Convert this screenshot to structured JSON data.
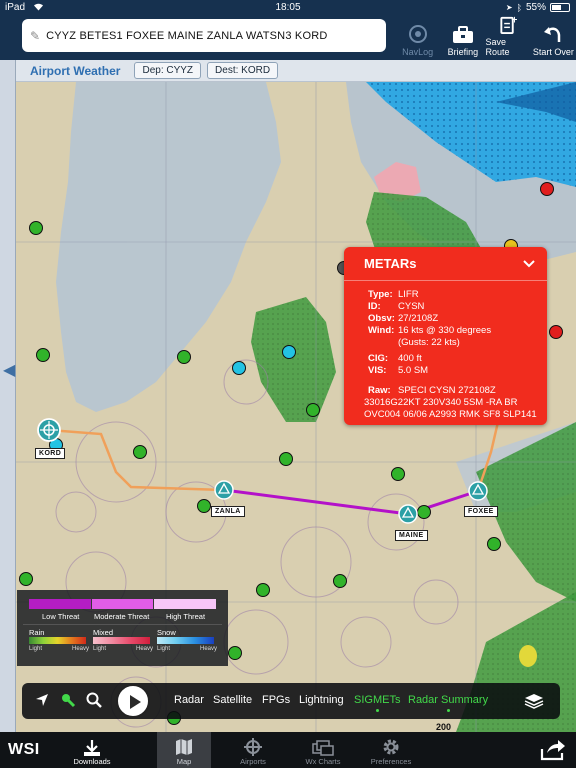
{
  "status_bar": {
    "device": "iPad",
    "wifi_icon": "wifi-icon",
    "time": "18:05",
    "battery": "55%",
    "battery_level": 0.55
  },
  "header": {
    "route": "CYYZ BETES1 FOXEE MAINE ZANLA WATSN3 KORD",
    "tools": [
      {
        "label": "NavLog",
        "icon": "target-icon",
        "enabled": false
      },
      {
        "label": "Briefing",
        "icon": "briefcase-icon",
        "enabled": true
      },
      {
        "label": "Save Route",
        "icon": "save-route-icon",
        "enabled": true
      },
      {
        "label": "Start Over",
        "icon": "undo-icon",
        "enabled": true
      }
    ]
  },
  "airport_weather": {
    "title": "Airport Weather",
    "dep": "Dep: CYYZ",
    "dest": "Dest: KORD"
  },
  "map": {
    "airports": [
      "KORD",
      "ZANLA",
      "MAINE",
      "FOXEE"
    ],
    "colors": {
      "route": "#b311c9",
      "path": "#f0a05a",
      "metar_green": "#31b32a",
      "metar_cyan": "#23c3e4",
      "metar_red": "#e01e1e",
      "airmet": "#3ba83a",
      "sigmet": "#1c9ae0"
    },
    "map_label": "200"
  },
  "metar_popup": {
    "title": "METARs",
    "rows": [
      {
        "k": "Type:",
        "v": "LIFR"
      },
      {
        "k": "ID:",
        "v": "CYSN"
      },
      {
        "k": "Obsv:",
        "v": "27/2108Z"
      },
      {
        "k": "Wind:",
        "v": "16 kts @ 330 degrees",
        "v2": "(Gusts: 22 kts)"
      },
      {
        "k": "CIG:",
        "v": "400 ft"
      },
      {
        "k": "VIS:",
        "v": "5.0 SM"
      }
    ],
    "raw_label": "Raw:",
    "raw": "SPECI CYSN 272108Z 33016G22KT 230V340 5SM -RA BR OVC004 06/06 A2993 RMK SF8 SLP141"
  },
  "legend": {
    "threats": [
      {
        "label": "Low Threat",
        "color": "#b41dc4"
      },
      {
        "label": "Moderate Threat",
        "color": "#e15de7"
      },
      {
        "label": "High Threat",
        "color": "#f7c6f7"
      }
    ],
    "weather": [
      {
        "label": "Rain",
        "light": "Light",
        "heavy": "Heavy"
      },
      {
        "label": "Mixed",
        "light": "Light",
        "heavy": "Heavy"
      },
      {
        "label": "Snow",
        "light": "Light",
        "heavy": "Heavy"
      }
    ]
  },
  "controls": {
    "tabs": [
      "Radar",
      "Satellite",
      "FPGs",
      "Lightning",
      "SIGMETs",
      "Radar Summary"
    ],
    "active": [
      "SIGMETs",
      "Radar Summary"
    ]
  },
  "tabbar": {
    "logo": "WSI",
    "tabs": [
      {
        "label": "Downloads",
        "icon": "download-icon"
      },
      {
        "label": "Map",
        "icon": "map-icon"
      },
      {
        "label": "Airports",
        "icon": "airport-icon"
      },
      {
        "label": "Wx Charts",
        "icon": "charts-icon"
      },
      {
        "label": "Preferences",
        "icon": "gear-icon"
      }
    ],
    "active": "Map",
    "share_icon": "share-icon"
  }
}
